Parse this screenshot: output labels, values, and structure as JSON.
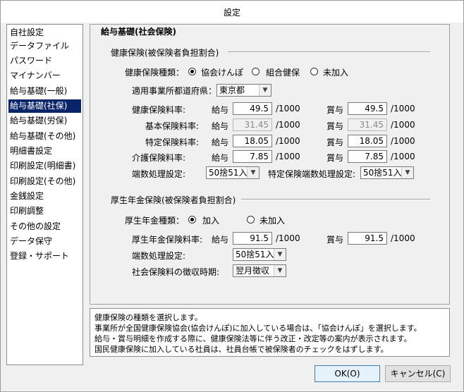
{
  "window": {
    "title": "設定"
  },
  "nav": {
    "items": [
      "自社設定",
      "データファイル",
      "パスワード",
      "マイナンバー",
      "給与基礎(一般)",
      "給与基礎(社保)",
      "給与基礎(労保)",
      "給与基礎(その他)",
      "明細書設定",
      "印刷設定(明細書)",
      "印刷設定(その他)",
      "金銭設定",
      "印刷調整",
      "その他の設定",
      "データ保守",
      "登録・サポート"
    ],
    "selected_index": 5
  },
  "panel": {
    "title": "給与基礎(社会保険)",
    "health": {
      "section_label": "健康保険(被保険者負担割合)",
      "type_label": "健康保険種類：",
      "type_options": [
        "協会けんぽ",
        "組合健保",
        "未加入"
      ],
      "type_selected": "協会けんぽ",
      "prefecture_label": "適用事業所都道府県：",
      "prefecture_value": "東京都",
      "rate_label": "健康保険料率:",
      "basic_rate_label": "基本保険料率:",
      "specific_rate_label": "特定保険料率:",
      "care_rate_label": "介護保険料率:",
      "salary_label": "給与",
      "bonus_label": "賞与",
      "unit": "/1000",
      "rate_salary": "49.5",
      "rate_bonus": "49.5",
      "basic_salary": "31.45",
      "basic_bonus": "31.45",
      "specific_salary": "18.05",
      "specific_bonus": "18.05",
      "care_salary": "7.85",
      "care_bonus": "7.85",
      "rounding_label": "端数処理設定:",
      "rounding_value": "50捨51入",
      "specific_rounding_label": "特定保険端数処理設定:",
      "specific_rounding_value": "50捨51入"
    },
    "pension": {
      "section_label": "厚生年金保険(被保険者負担割合)",
      "type_label": "厚生年金種類：",
      "type_options": [
        "加入",
        "未加入"
      ],
      "type_selected": "加入",
      "rate_label": "厚生年金保険料率:",
      "salary_label": "給与",
      "bonus_label": "賞与",
      "unit": "/1000",
      "rate_salary": "91.5",
      "rate_bonus": "91.5",
      "rounding_label": "端数処理設定:",
      "rounding_value": "50捨51入",
      "collection_label": "社会保険料の徴収時期:",
      "collection_value": "翌月徴収"
    }
  },
  "description": {
    "lines": [
      "健康保険の種類を選択します。",
      "事業所が全国健康保険協会(協会けんぽ)に加入している場合は、「協会けんぽ」を選択します。",
      "給与・賞与明細を作成する際に、健康保険法等に伴う改正・改定等の案内が表示されます。",
      "国民健康保険に加入している社員は、社員台帳で被保険者のチェックをはずします。"
    ]
  },
  "buttons": {
    "ok": "OK(O)",
    "cancel": "キャンセル(C)"
  }
}
